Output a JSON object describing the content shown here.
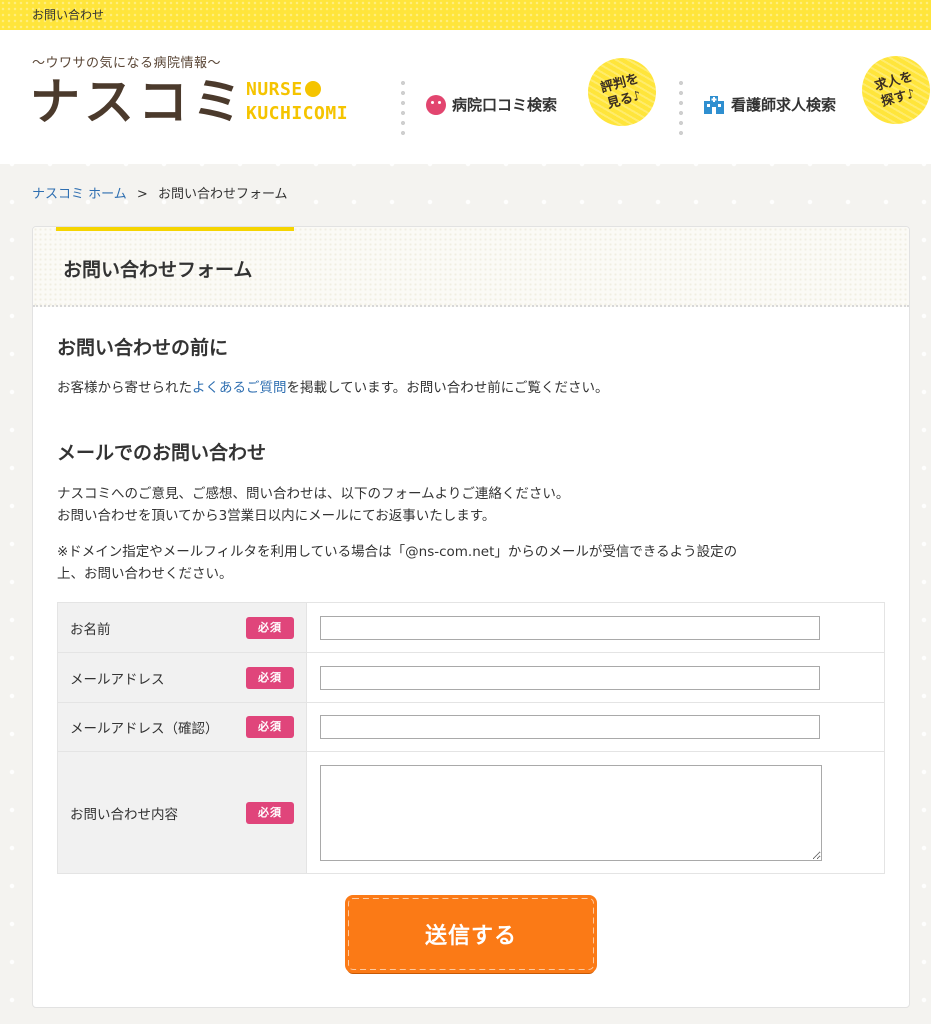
{
  "topbar": {
    "label": "お問い合わせ"
  },
  "header": {
    "tagline": "〜ウワサの気になる病院情報〜",
    "logo_jp": "ナスコミ",
    "logo_en_line1": "NURSE",
    "logo_en_line2": "KUCHICOMI",
    "nav": [
      {
        "label": "病院口コミ検索",
        "icon": "smile-face-icon",
        "badge": [
          "評判を",
          "見る♪"
        ]
      },
      {
        "label": "看護師求人検索",
        "icon": "hospital-icon",
        "badge": [
          "求人を",
          "探す♪"
        ]
      }
    ],
    "colors": {
      "yellow": "#ffe53b",
      "brown": "#4b3a2c",
      "pink": "#e2456f",
      "blue": "#2f8fd0"
    }
  },
  "breadcrumb": {
    "home": "ナスコミ ホーム",
    "separator": ">",
    "current": "お問い合わせフォーム"
  },
  "page": {
    "title": "お問い合わせフォーム",
    "before": {
      "heading": "お問い合わせの前に",
      "text_pre": "お客様から寄せられた",
      "link": "よくあるご質問",
      "text_post": "を掲載しています。お問い合わせ前にご覧ください。"
    },
    "mail": {
      "heading": "メールでのお問い合わせ",
      "line1": "ナスコミへのご意見、ご感想、問い合わせは、以下のフォームよりご連絡ください。",
      "line2": "お問い合わせを頂いてから3営業日以内にメールにてお返事いたします。",
      "note1": "※ドメイン指定やメールフィルタを利用している場合は「@ns-com.net」からのメールが受信できるよう設定の",
      "note2": "上、お問い合わせください。"
    },
    "form": {
      "required_label": "必須",
      "fields": [
        {
          "label": "お名前",
          "value": ""
        },
        {
          "label": "メールアドレス",
          "value": ""
        },
        {
          "label": "メールアドレス（確認）",
          "value": ""
        },
        {
          "label": "お問い合わせ内容",
          "value": ""
        }
      ],
      "submit_label": "送信する",
      "submit_color": "#fb7a16"
    }
  }
}
